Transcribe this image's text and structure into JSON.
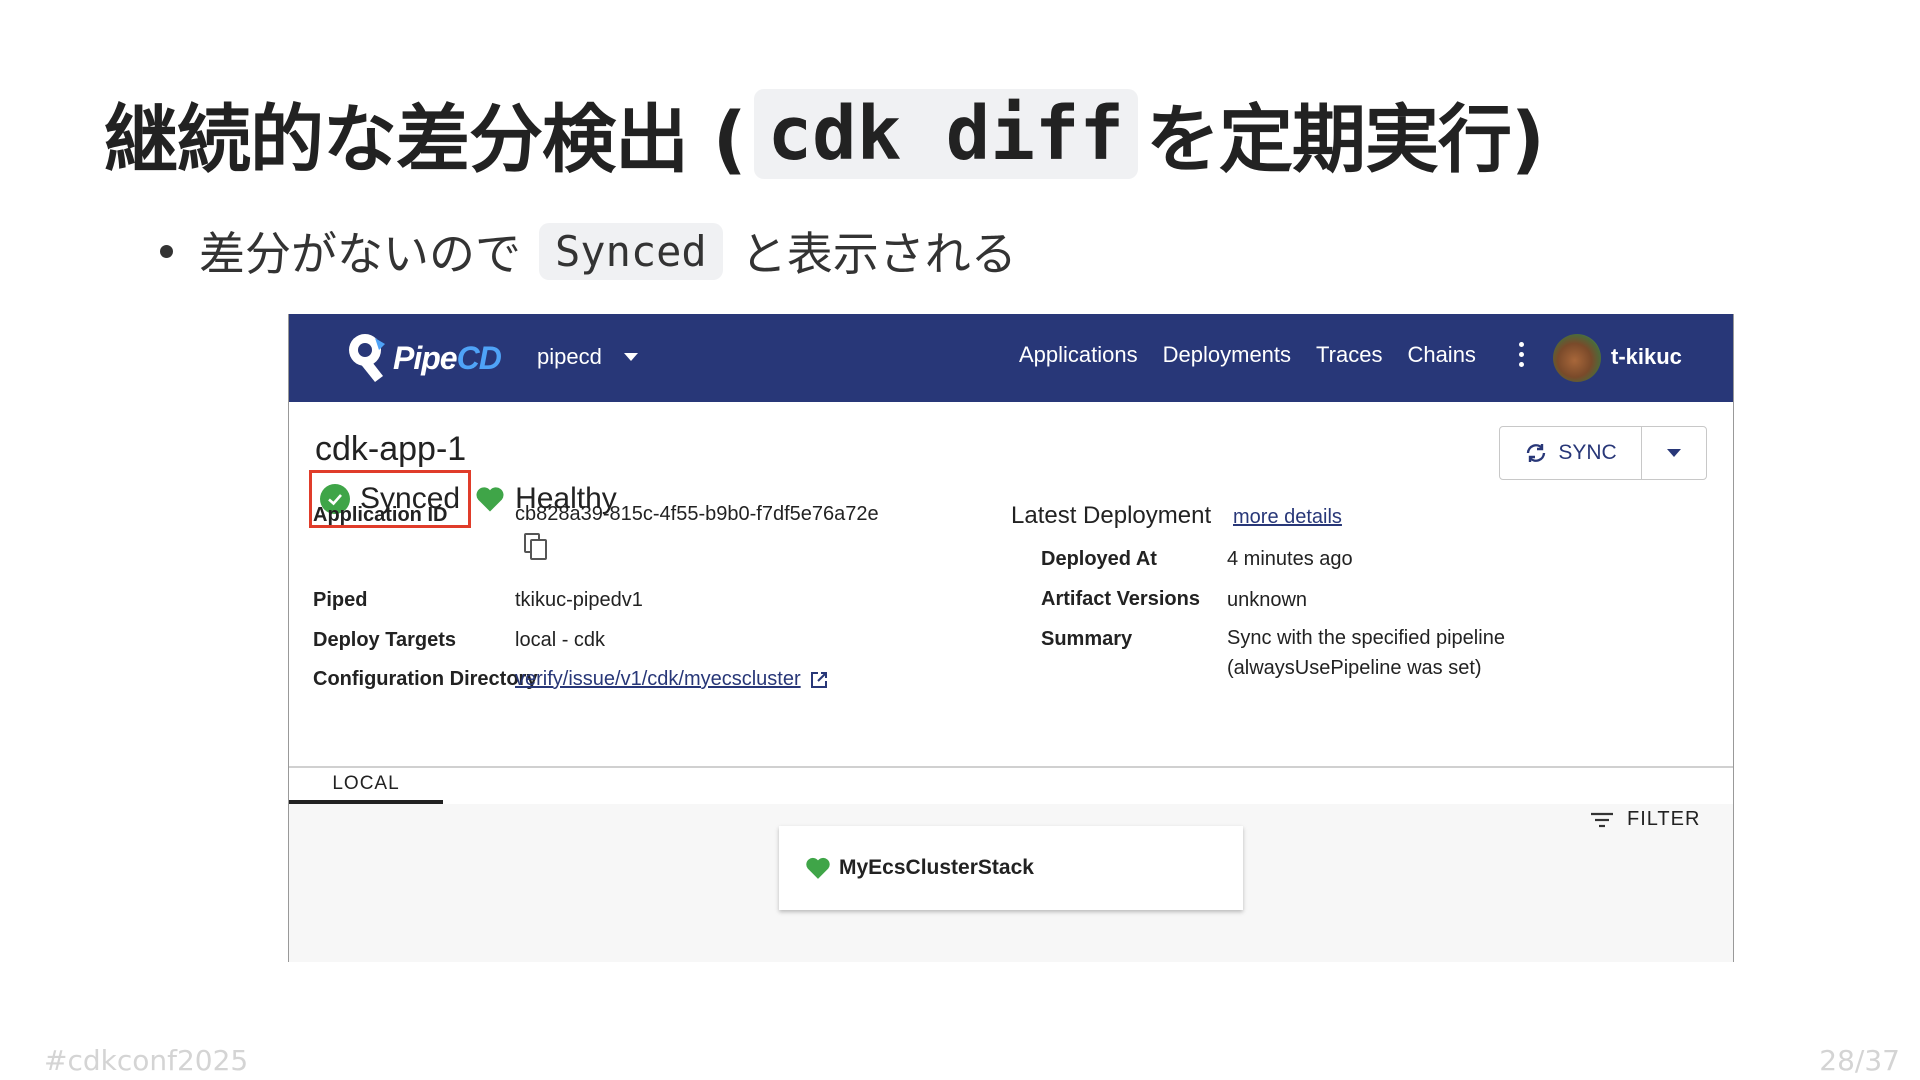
{
  "slide": {
    "title_prefix": "継続的な差分検出 (",
    "title_code": "cdk diff",
    "title_suffix": "を定期実行)",
    "bullet_prefix": "差分がないので",
    "bullet_code": "Synced",
    "bullet_suffix": "と表示される",
    "footer_tag": "#cdkconf2025",
    "page_number": "28/37"
  },
  "navbar": {
    "logo_text_pipe": "Pipe",
    "logo_text_cd": "CD",
    "project": "pipecd",
    "links": [
      "Applications",
      "Deployments",
      "Traces",
      "Chains"
    ],
    "user": "t-kikuc"
  },
  "app": {
    "name": "cdk-app-1",
    "sync_status": "Synced",
    "health_status": "Healthy",
    "sync_button": "SYNC",
    "details": {
      "application_id_label": "Application ID",
      "application_id": "cb828a39-815c-4f55-b9b0-f7df5e76a72e",
      "piped_label": "Piped",
      "piped": "tkikuc-pipedv1",
      "deploy_targets_label": "Deploy Targets",
      "deploy_targets": "local - cdk",
      "config_dir_label": "Configuration Directory",
      "config_dir": "verify/issue/v1/cdk/myecscluster"
    },
    "latest_deployment": {
      "heading": "Latest Deployment",
      "more_details": "more details",
      "deployed_at_label": "Deployed At",
      "deployed_at": "4 minutes ago",
      "artifact_versions_label": "Artifact Versions",
      "artifact_versions": "unknown",
      "summary_label": "Summary",
      "summary_line1": "Sync with the specified pipeline",
      "summary_line2": "(alwaysUsePipeline was set)"
    }
  },
  "resources": {
    "tab": "LOCAL",
    "filter": "FILTER",
    "stack": "MyEcsClusterStack"
  },
  "colors": {
    "navbar": "#283778",
    "synced": "#3fa548",
    "highlight": "#e03c2a"
  }
}
